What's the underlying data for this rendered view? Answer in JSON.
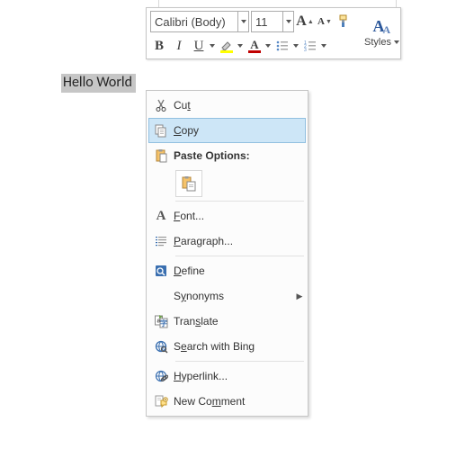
{
  "selection_text": "Hello World",
  "mini_toolbar": {
    "font_name": "Calibri (Body)",
    "font_size": "11",
    "styles_label": "Styles"
  },
  "context_menu": {
    "cut": "Cut",
    "copy": "Copy",
    "paste_options": "Paste Options:",
    "font": "Font...",
    "paragraph": "Paragraph...",
    "define": "Define",
    "synonyms": "Synonyms",
    "translate": "Translate",
    "search_bing": "Search with Bing",
    "hyperlink": "Hyperlink...",
    "new_comment": "New Comment"
  }
}
